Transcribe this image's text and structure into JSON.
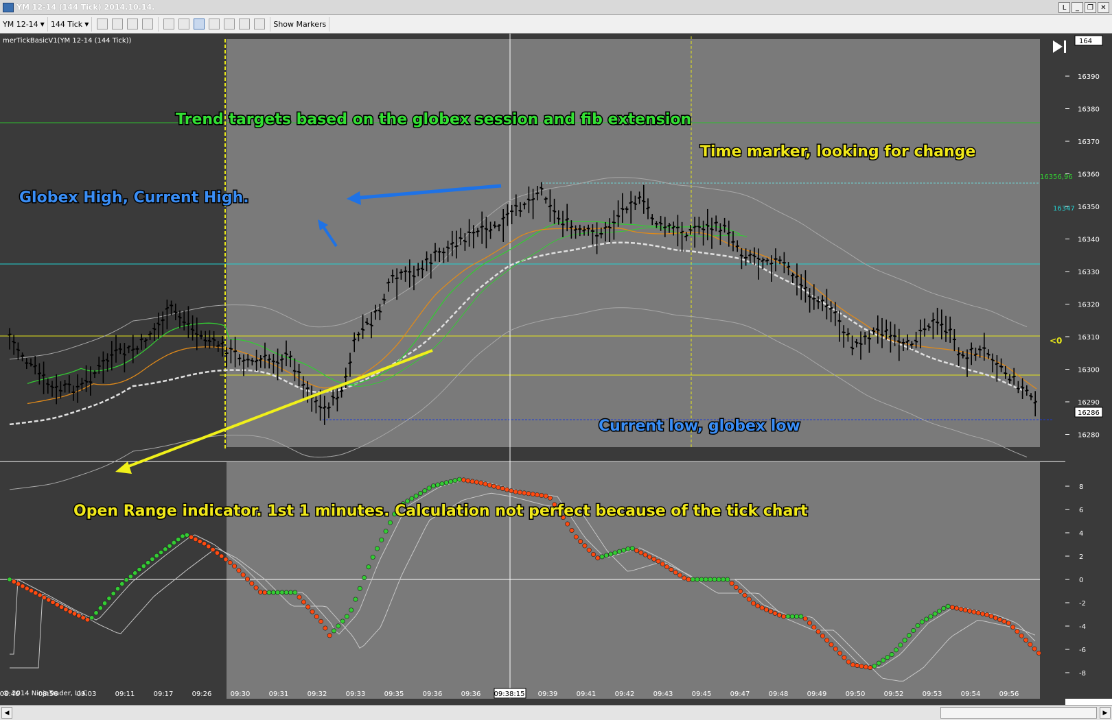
{
  "window": {
    "title": "YM 12-14 (144 Tick)  2014.10.14.",
    "buttons": [
      "L",
      "_",
      "❐",
      "✕"
    ]
  },
  "toolbar": {
    "instrument": "YM 12-14",
    "interval": "144 Tick",
    "show_markers": "Show Markers"
  },
  "chart": {
    "indicator_label": "merTickBasicV1(YM 12-14 (144 Tick))",
    "copyright": "© 2014 NinjaTrader, LLC",
    "price_ticks": [
      "16390",
      "16380",
      "16370",
      "16360",
      "16350",
      "16340",
      "16330",
      "16320",
      "16310",
      "16300",
      "16290",
      "16280"
    ],
    "price_top_label": "164",
    "current_price_label": "16286",
    "cyan_price_label": "16347",
    "green_price_label": "16356,96",
    "marker_label": "<0",
    "osc_ticks": [
      "8",
      "6",
      "4",
      "2",
      "0",
      "-2",
      "-4",
      "-6",
      "-8"
    ],
    "time_labels": [
      "08:46",
      "08:56",
      "09:03",
      "09:11",
      "09:17",
      "09:26",
      "09:30",
      "09:31",
      "09:32",
      "09:33",
      "09:35",
      "09:36",
      "09:36",
      "09:38:15",
      "09:39",
      "09:41",
      "09:42",
      "09:43",
      "09:45",
      "09:47",
      "09:48",
      "09:49",
      "09:50",
      "09:52",
      "09:53",
      "09:54",
      "09:56"
    ],
    "colors": {
      "pre_session_bg": "#3a3a3a",
      "session_bg": "#7a7a7a",
      "candle": "#000000",
      "osc_up": "#33cc33",
      "osc_down": "#ff4a10"
    }
  },
  "annotations": {
    "trend_targets": "Trend targets based on the globex session and fib extension",
    "time_marker": "Time marker, looking for change",
    "globex_high": "Globex High, Current High.",
    "current_low": "Current low, globex low",
    "open_range": "Open Range indicator. 1st 1 minutes. Calculation not perfect because of the tick chart"
  }
}
